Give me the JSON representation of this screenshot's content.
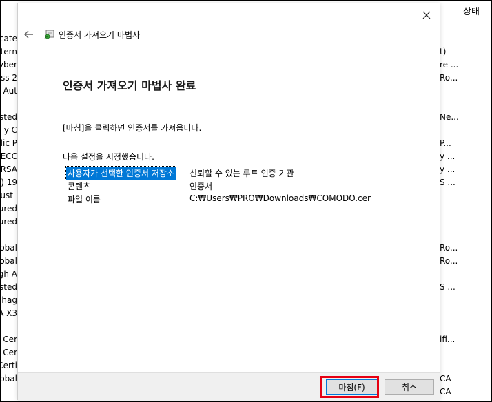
{
  "background": {
    "status_header": "상태",
    "left_rows": [
      "cate",
      "tern",
      "yber",
      "ss 2",
      "Aut",
      "sted",
      "y C",
      "lic P",
      "ECC",
      "RSA",
      "c) 19",
      "rust_",
      "sured",
      "sured",
      "obal",
      "obal",
      "gh A",
      "sted",
      "ehag",
      "A X3",
      "t Cer",
      "t Cer",
      "Certi",
      "obal"
    ],
    "right_rows": [
      "t)",
      "re ...",
      "Ro...",
      "Ne...",
      "P...",
      "y ...",
      "y ...",
      "S ...",
      "Ro...",
      "Ro...",
      "S ...",
      "ifi...",
      "CA",
      "CA"
    ]
  },
  "dialog": {
    "wizard_title": "인증서 가져오기 마법사",
    "heading": "인증서 가져오기 마법사 완료",
    "instruction": "[마침]을 클릭하면 인증서를 가져옵니다.",
    "settings_label": "다음 설정을 지정했습니다.",
    "settings": [
      {
        "key": "사용자가 선택한 인증서 저장소",
        "value": "신뢰할 수 있는 루트 인증 기관"
      },
      {
        "key": "콘텐츠",
        "value": "인증서"
      },
      {
        "key": "파일 이름",
        "value": "C:₩Users₩PRO₩Downloads₩COMODO.cer"
      }
    ],
    "finish_label": "마침(F)",
    "cancel_label": "취소"
  },
  "icons": {
    "close": "close-icon",
    "back": "back-arrow-icon",
    "wizard": "certificate-wizard-icon"
  },
  "colors": {
    "selection": "#0078d7",
    "highlight": "#e60012"
  }
}
